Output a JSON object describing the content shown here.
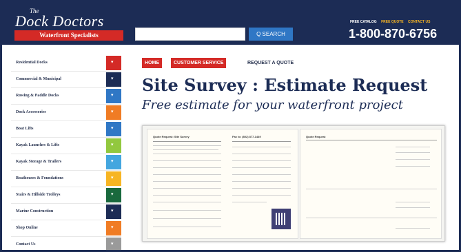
{
  "brand": {
    "prefix": "The",
    "name": "Dock Doctors",
    "tagline": "Waterfront Specialists",
    "accent": "#d42a26",
    "navy": "#1c2c55"
  },
  "search": {
    "placeholder": "",
    "button_label": "Q SEARCH"
  },
  "header": {
    "links": [
      "FREE CATALOG",
      "FREE QUOTE",
      "CONTACT US"
    ],
    "phone": "1-800-870-6756"
  },
  "sidebar": {
    "items": [
      {
        "label": "Residential Docks",
        "color": "#d42a26"
      },
      {
        "label": "Commercial & Municipal",
        "color": "#1c2c55"
      },
      {
        "label": "Rowing & Paddle Docks",
        "color": "#2f77c5"
      },
      {
        "label": "Dock Accessories",
        "color": "#f07c24"
      },
      {
        "label": "Boat Lifts",
        "color": "#2f77c5"
      },
      {
        "label": "Kayak Launches & Lifts",
        "color": "#92c83e"
      },
      {
        "label": "Kayak Storage & Trailers",
        "color": "#43a6df"
      },
      {
        "label": "Boathouses & Foundations",
        "color": "#f7b523"
      },
      {
        "label": "Stairs & Hillside Trolleys",
        "color": "#19693d"
      },
      {
        "label": "Marine Construction",
        "color": "#1c2c55"
      },
      {
        "label": "Shop Online",
        "color": "#f07c24"
      },
      {
        "label": "Contact Us",
        "color": "#9a9a9a"
      }
    ]
  },
  "breadcrumb": {
    "home": "HOME",
    "section": "CUSTOMER SERVICE",
    "current": "REQUEST A QUOTE"
  },
  "main": {
    "title": "Site Survey : Estimate Request",
    "subtitle": "Free estimate for your waterfront project"
  },
  "form_preview": {
    "left_heading": "Quote Request: Site Survey",
    "fax_label": "Fax to: (802) 877-1449",
    "right_heading": "Quote Request"
  }
}
